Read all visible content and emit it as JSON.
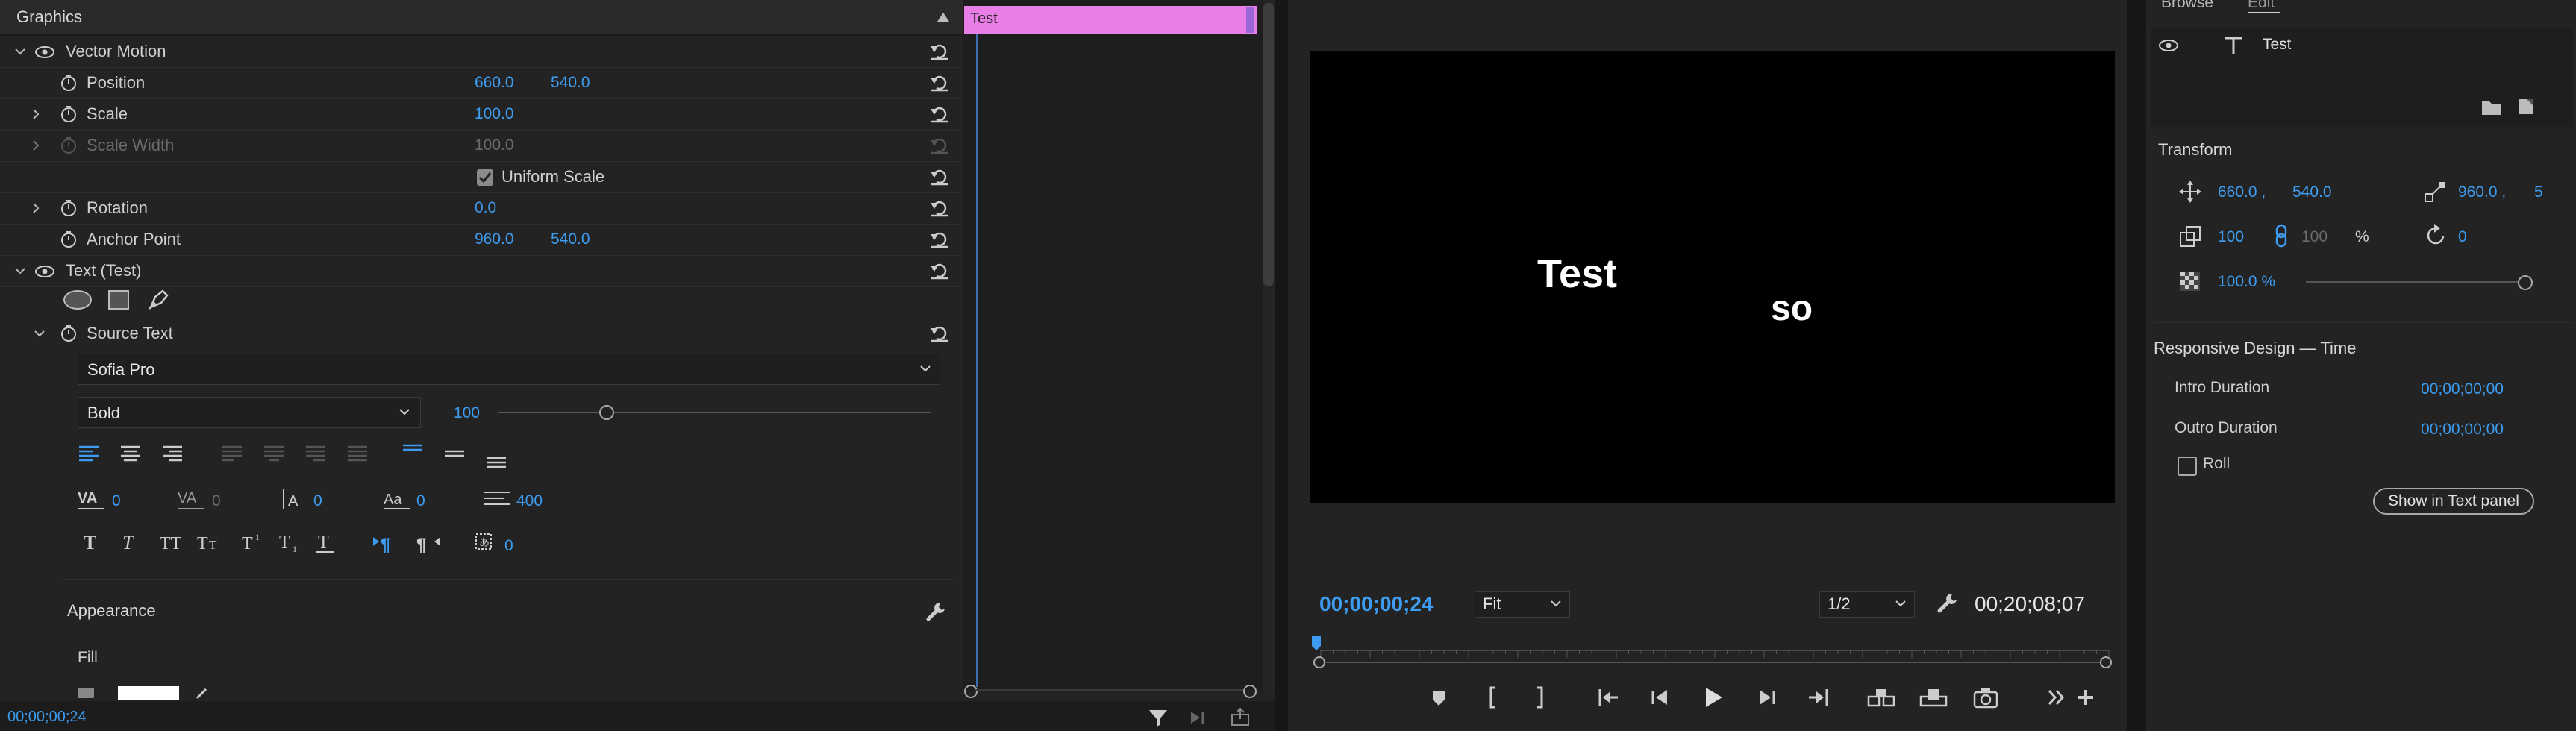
{
  "effect_controls": {
    "panel_title": "Graphics",
    "vector_motion": {
      "label": "Vector Motion",
      "position": {
        "label": "Position",
        "x": "660.0",
        "y": "540.0"
      },
      "scale": {
        "label": "Scale",
        "value": "100.0"
      },
      "scale_width": {
        "label": "Scale Width",
        "value": "100.0"
      },
      "uniform_scale": {
        "label": "Uniform Scale"
      },
      "rotation": {
        "label": "Rotation",
        "value": "0.0"
      },
      "anchor_point": {
        "label": "Anchor Point",
        "x": "960.0",
        "y": "540.0"
      }
    },
    "text_layer": {
      "label": "Text (Test)",
      "source_text": "Source Text",
      "font": "Sofia Pro",
      "style": "Bold",
      "size": "100",
      "size_slider_fraction": 0.25,
      "kerning": "0",
      "tracking": "0",
      "leading": "0",
      "baseline": "0",
      "tab_width": "400",
      "tsume": "0"
    },
    "appearance": "Appearance",
    "fill": "Fill",
    "current_time": "00;00;00;24"
  },
  "timeline": {
    "clip_label": "Test"
  },
  "program": {
    "texts": [
      "Test",
      "so"
    ],
    "timecode": "00;00;00;24",
    "fit": "Fit",
    "resolution": "1/2",
    "duration": "00;20;08;07"
  },
  "essential_graphics": {
    "tabs": [
      "Browse",
      "Edit"
    ],
    "layer_name": "Test",
    "transform_title": "Transform",
    "position_x": "660.0 ,",
    "position_y": "540.0",
    "anchor_x": "960.0 ,",
    "anchor_y": "5",
    "scale": "100",
    "scale_width": "100",
    "percent": "%",
    "rotation": "0",
    "opacity": "100.0 %",
    "opacity_fraction": 1.0,
    "responsive_title": "Responsive Design — Time",
    "intro_label": "Intro Duration",
    "intro_value": "00;00;00;00",
    "outro_label": "Outro Duration",
    "outro_value": "00;00;00;00",
    "roll_label": "Roll",
    "show_button": "Show in Text panel"
  }
}
